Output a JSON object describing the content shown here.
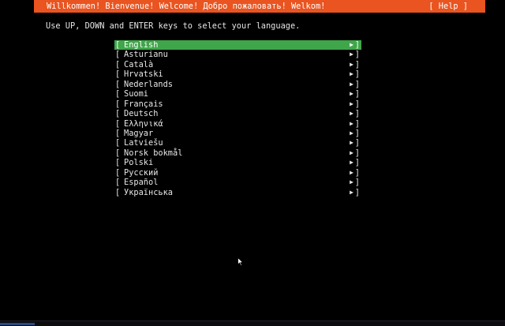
{
  "header": {
    "title": "Willkommen! Bienvenue! Welcome! Добро пожаловать! Welkom!",
    "help": "[ Help ]",
    "color": "#e95420"
  },
  "instructions": "Use UP, DOWN and ENTER keys to select your language.",
  "languages": {
    "selected_color": "#3fa64a",
    "open_bracket": "[",
    "close_bracket": "]",
    "arrow": "▶",
    "items": [
      "English",
      "Asturianu",
      "Català",
      "Hrvatski",
      "Nederlands",
      "Suomi",
      "Français",
      "Deutsch",
      "Ελληνικά",
      "Magyar",
      "Latviešu",
      "Norsk bokmål",
      "Polski",
      "Русский",
      "Español",
      "Українська"
    ],
    "selected_index": 0
  },
  "icons": {
    "cursor": "mouse-cursor-icon",
    "arrow": "triangle-right-icon"
  }
}
